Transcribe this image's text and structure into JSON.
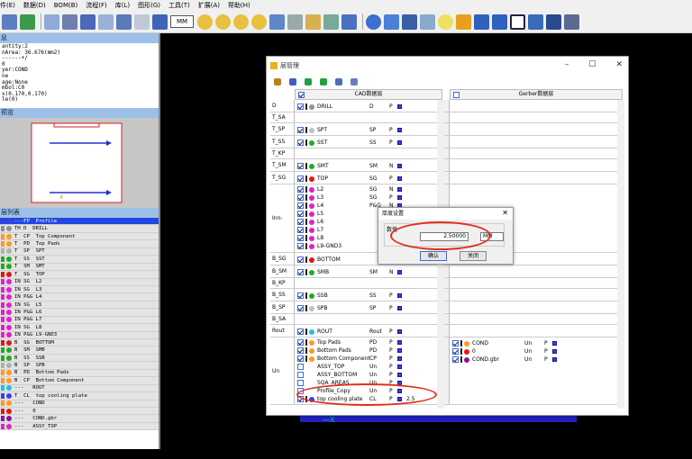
{
  "menu": [
    "件(E)",
    "数据(D)",
    "BOM(B)",
    "流程(F)",
    "库(L)",
    "图形(G)",
    "工具(T)",
    "扩展(A)",
    "帮助(H)"
  ],
  "toolbar": {
    "unit": "MM"
  },
  "panels": {
    "info_title": "息",
    "preview_title": "预览",
    "list_title": "层列表"
  },
  "props": "antity:2\nnArea: 36.676(mm2)\n------+/\n0\nyer:COND\nne\nage:None\nmbol:C0\nx(0.170,0.170)\nle(0)",
  "layer_list": [
    {
      "t": "---FP  Profile",
      "c": "#3b3fe0",
      "sel": true
    },
    {
      "t": "TH D  DRILL",
      "c": "#909090"
    },
    {
      "t": "T  CP  Top Component",
      "c": "#ff9a20"
    },
    {
      "t": "T  PD  Top Pads",
      "c": "#ff9a20"
    },
    {
      "t": "T  SP  SPT",
      "c": "#b0b0b0"
    },
    {
      "t": "T  SS  SST",
      "c": "#22aa22"
    },
    {
      "t": "T  SM  SMT",
      "c": "#22aa22"
    },
    {
      "t": "T  SG  TOP",
      "c": "#e01818"
    },
    {
      "t": "IN SG  L2",
      "c": "#e020c8"
    },
    {
      "t": "IN SG  L3",
      "c": "#e020c8"
    },
    {
      "t": "IN P&G L4",
      "c": "#e020c8"
    },
    {
      "t": "IN SG  L5",
      "c": "#e020c8"
    },
    {
      "t": "IN P&G L6",
      "c": "#e020c8"
    },
    {
      "t": "IN P&G L7",
      "c": "#e020c8"
    },
    {
      "t": "IN SG  L8",
      "c": "#e020c8"
    },
    {
      "t": "IN P&G L9-GND3",
      "c": "#e020c8"
    },
    {
      "t": "B  SG  BOTTOM",
      "c": "#e01818"
    },
    {
      "t": "B  SM  SMB",
      "c": "#22aa22"
    },
    {
      "t": "B  SS  SSB",
      "c": "#22aa22"
    },
    {
      "t": "B  SP  SPB",
      "c": "#b0b0b0"
    },
    {
      "t": "B  PD  Bottom Pads",
      "c": "#ff9a20"
    },
    {
      "t": "B  CP  Bottom Component",
      "c": "#ff9a20"
    },
    {
      "t": "---   ROUT",
      "c": "#20c0e0"
    },
    {
      "t": "T  CL  top cooling plate",
      "c": "#3b3fe0"
    },
    {
      "t": "---   COND",
      "c": "#ff9a20"
    },
    {
      "t": "---   0",
      "c": "#e01818"
    },
    {
      "t": "---   COND.gbr",
      "c": "#8b12a0"
    },
    {
      "t": "---   ASSY_TOP",
      "c": "#e020c8"
    }
  ],
  "dialog": {
    "title": "层管理",
    "cad_header": "CAD数据层",
    "gerber_header": "Gerber数据层"
  },
  "rows": [
    {
      "label": "D",
      "h": 14,
      "items": [
        {
          "n": "DRILL",
          "a": "D",
          "l": "P",
          "c": "#909090"
        }
      ]
    },
    {
      "label": "T_SA",
      "h": 12,
      "items": []
    },
    {
      "label": "T_SP",
      "h": 14,
      "items": [
        {
          "n": "SPT",
          "a": "SP",
          "l": "P",
          "c": "#c0c0c0"
        }
      ]
    },
    {
      "label": "T_SS",
      "h": 14,
      "items": [
        {
          "n": "SST",
          "a": "SS",
          "l": "P",
          "c": "#22aa22"
        }
      ]
    },
    {
      "label": "T_KP",
      "h": 12,
      "items": []
    },
    {
      "label": "T_SM",
      "h": 14,
      "items": [
        {
          "n": "SMT",
          "a": "SM",
          "l": "N",
          "c": "#22aa22"
        }
      ]
    },
    {
      "label": "T_SG",
      "h": 14,
      "items": [
        {
          "n": "TOP",
          "a": "SG",
          "l": "P",
          "c": "#e01818"
        }
      ]
    },
    {
      "label": "Inn-",
      "h": 76,
      "items": [
        {
          "n": "L2",
          "a": "SG",
          "l": "N",
          "c": "#e020c8"
        },
        {
          "n": "L3",
          "a": "SG",
          "l": "P",
          "c": "#e020c8"
        },
        {
          "n": "L4",
          "a": "P&G",
          "l": "N",
          "c": "#e020c8"
        },
        {
          "n": "L5",
          "a": "",
          "l": "",
          "c": "#e020c8"
        },
        {
          "n": "L6",
          "a": "",
          "l": "",
          "c": "#e020c8"
        },
        {
          "n": "L7",
          "a": "",
          "l": "",
          "c": "#e020c8"
        },
        {
          "n": "L8",
          "a": "",
          "l": "",
          "c": "#e020c8"
        },
        {
          "n": "L9-GND3",
          "a": "",
          "l": "",
          "c": "#e020c8"
        }
      ]
    },
    {
      "label": "B_SG",
      "h": 14,
      "items": [
        {
          "n": "BOTTOM",
          "a": "",
          "l": "",
          "c": "#e01818"
        }
      ]
    },
    {
      "label": "B_SM",
      "h": 14,
      "items": [
        {
          "n": "SMB",
          "a": "SM",
          "l": "N",
          "c": "#22aa22"
        }
      ]
    },
    {
      "label": "B_KP",
      "h": 12,
      "items": []
    },
    {
      "label": "B_SS",
      "h": 14,
      "items": [
        {
          "n": "SSB",
          "a": "SS",
          "l": "P",
          "c": "#22aa22"
        }
      ]
    },
    {
      "label": "B_SP",
      "h": 14,
      "items": [
        {
          "n": "SPB",
          "a": "SP",
          "l": "P",
          "c": "#c0c0c0"
        }
      ]
    },
    {
      "label": "B_SA",
      "h": 12,
      "items": []
    },
    {
      "label": "Rout",
      "h": 14,
      "items": [
        {
          "n": "ROUT",
          "a": "Rout",
          "l": "P",
          "c": "#20c0e0"
        }
      ]
    },
    {
      "label": "Un",
      "h": 75,
      "items": [
        {
          "n": "Top Pads",
          "a": "PD",
          "l": "P",
          "c": "#ff9a20"
        },
        {
          "n": "Bottom Pads",
          "a": "PD",
          "l": "P",
          "c": "#ff9a20"
        },
        {
          "n": "Bottom Component",
          "a": "CP",
          "l": "P",
          "c": "#ff9a20"
        },
        {
          "n": "ASSY_TOP",
          "a": "Un",
          "l": "P",
          "c": ""
        },
        {
          "n": "ASSY_BOTTOM",
          "a": "Un",
          "l": "P",
          "c": ""
        },
        {
          "n": "SQA_AREAS",
          "a": "Un",
          "l": "P",
          "c": ""
        },
        {
          "n": "Profile_Copy",
          "a": "Un",
          "l": "P",
          "c": ""
        },
        {
          "n": "top cooling plate",
          "a": "CL",
          "l": "P",
          "c": "#3b3fe0",
          "v": "2.5"
        }
      ],
      "gerber": [
        {
          "n": "COND",
          "a": "Un",
          "l": "P",
          "c": "#ff9a20"
        },
        {
          "n": "0",
          "a": "Un",
          "l": "P",
          "c": "#e01818"
        },
        {
          "n": "COND.gbr",
          "a": "Un",
          "l": "P",
          "c": "#8b12a0"
        }
      ]
    }
  ],
  "thickness_dialog": {
    "title": "厚度设置",
    "group_label": "数值",
    "value": "2.50000",
    "unit": "MM",
    "ok": "确认",
    "cancel": "关闭"
  }
}
